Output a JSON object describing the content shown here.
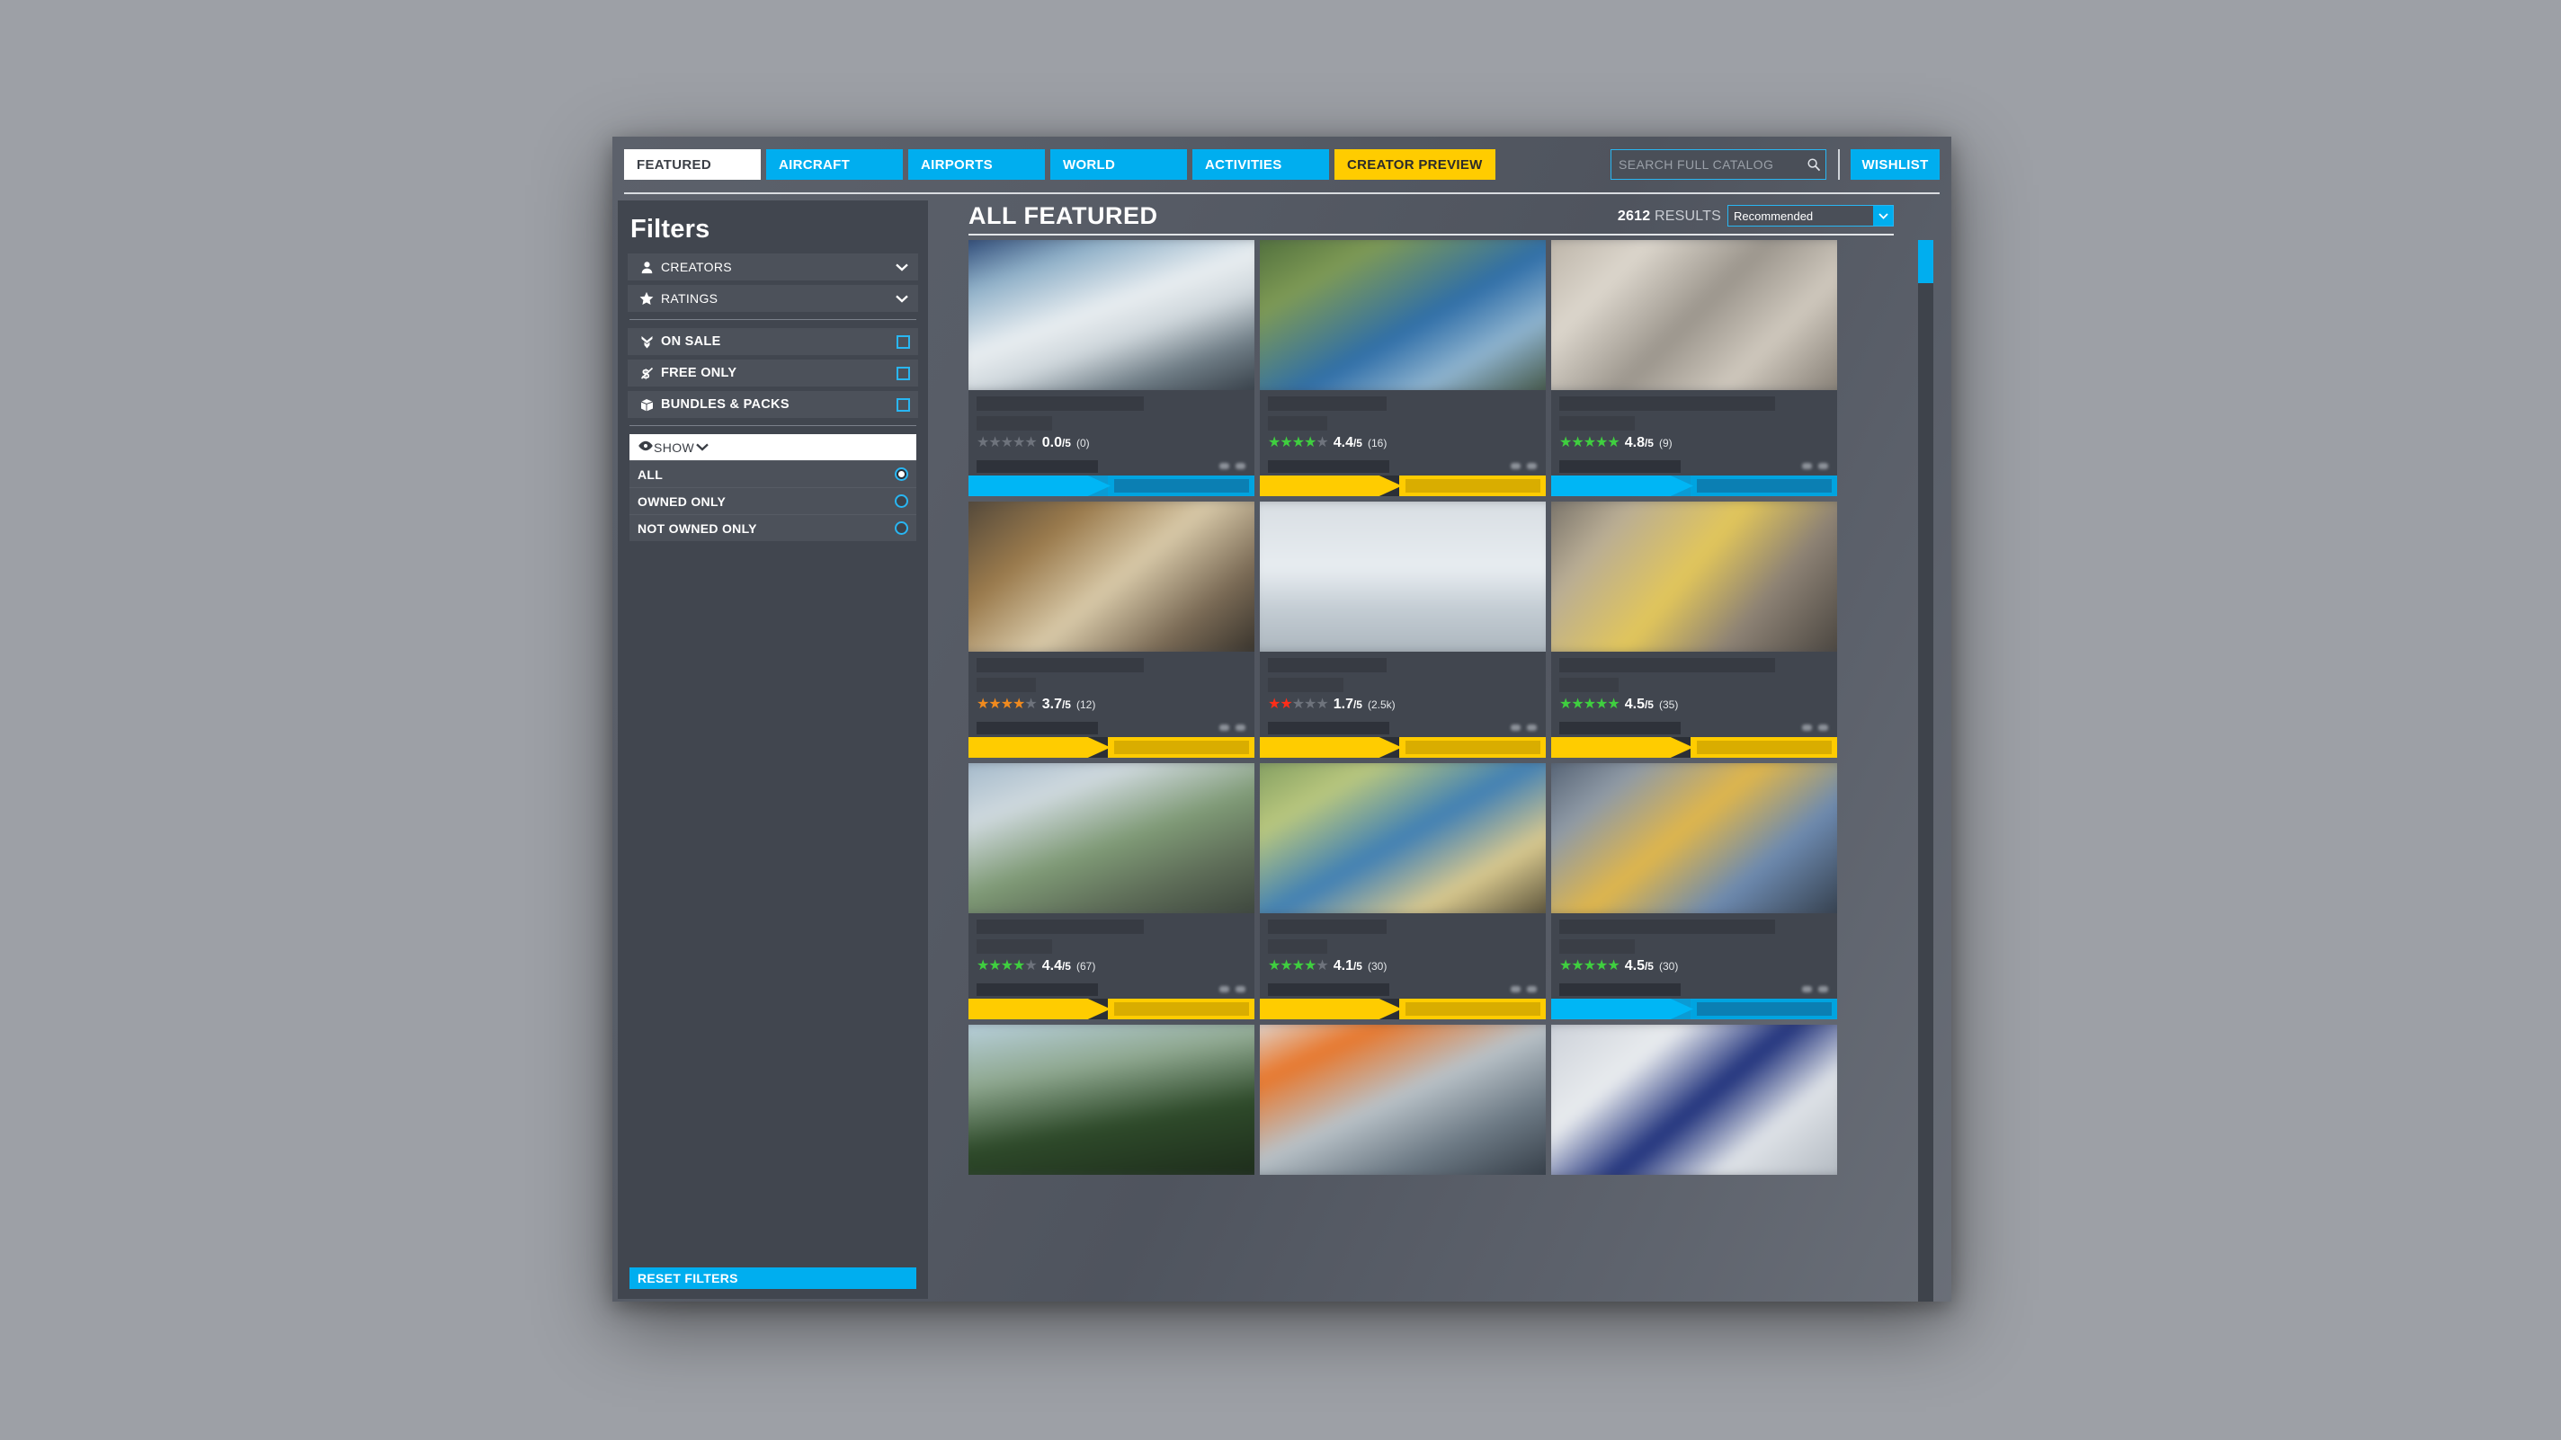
{
  "nav": {
    "tabs": [
      {
        "label": "FEATURED",
        "state": "active"
      },
      {
        "label": "AIRCRAFT",
        "state": "normal"
      },
      {
        "label": "AIRPORTS",
        "state": "normal"
      },
      {
        "label": "WORLD",
        "state": "normal"
      },
      {
        "label": "ACTIVITIES",
        "state": "normal"
      },
      {
        "label": "CREATOR PREVIEW",
        "state": "creator"
      }
    ],
    "search_placeholder": "SEARCH FULL CATALOG",
    "search_value": "",
    "wishlist_label": "WISHLIST"
  },
  "sidebar": {
    "title": "Filters",
    "collapsibles": [
      {
        "label": "CREATORS",
        "icon": "person-icon"
      },
      {
        "label": "RATINGS",
        "icon": "star-icon"
      }
    ],
    "checkboxes": [
      {
        "label": "ON SALE",
        "icon": "double-chevron-down-icon",
        "checked": false
      },
      {
        "label": "FREE ONLY",
        "icon": "dollar-slash-icon",
        "checked": false
      },
      {
        "label": "BUNDLES & PACKS",
        "icon": "box-icon",
        "checked": false
      }
    ],
    "show": {
      "label": "SHOW",
      "icon": "eye-icon",
      "expanded": true,
      "options": [
        {
          "label": "ALL",
          "selected": true
        },
        {
          "label": "OWNED ONLY",
          "selected": false
        },
        {
          "label": "NOT OWNED ONLY",
          "selected": false
        }
      ]
    },
    "reset_label": "RESET FILTERS"
  },
  "content": {
    "title": "ALL FEATURED",
    "results_count": "2612",
    "results_suffix": "RESULTS",
    "sort_value": "Recommended",
    "cards": [
      {
        "rating": "0.0",
        "scale": "/5",
        "count": "(0)",
        "stars_filled": 0,
        "star_color": "#6e737c",
        "bar": "blue",
        "img": "linear-gradient(160deg,#1f3a6b 0%,#8fb0c8 22%,#e9eef1 46%,#cfd7dc 60%,#6f7d86 78%,#2f3740 100%)"
      },
      {
        "rating": "4.4",
        "scale": "/5",
        "count": "(16)",
        "stars_filled": 4,
        "star_color": "#3fcf3f",
        "bar": "yellow",
        "img": "linear-gradient(150deg,#4b6a3a 0%,#7e9a55 25%,#2f6ea8 55%,#8fb4cf 75%,#3a4a35 100%)"
      },
      {
        "rating": "4.8",
        "scale": "/5",
        "count": "(9)",
        "stars_filled": 5,
        "star_color": "#3fcf3f",
        "bar": "blue",
        "img": "linear-gradient(135deg,#b8b0a4 0%,#dcd6cc 25%,#9b958c 50%,#cfc8bd 72%,#7d766d 100%)"
      },
      {
        "rating": "3.7",
        "scale": "/5",
        "count": "(12)",
        "stars_filled": 4,
        "star_color": "#f08a1e",
        "bar": "yellow",
        "img": "linear-gradient(140deg,#4a4238 0%,#9a7a4c 28%,#d8c9a8 52%,#7a6a55 76%,#2e2b26 100%)"
      },
      {
        "rating": "1.7",
        "scale": "/5",
        "count": "(2.5k)",
        "stars_filled": 2,
        "star_color": "#ff2d18",
        "bar": "yellow",
        "img": "linear-gradient(180deg,#d7dde2 0%,#e8edf1 45%,#c3ccd3 70%,#aab4bc 100%)"
      },
      {
        "rating": "4.5",
        "scale": "/5",
        "count": "(35)",
        "stars_filled": 5,
        "star_color": "#3fcf3f",
        "bar": "yellow",
        "img": "linear-gradient(130deg,#6f6a63 0%,#b9ad95 22%,#e2c65a 48%,#8d8275 70%,#433f3a 100%)"
      },
      {
        "rating": "4.4",
        "scale": "/5",
        "count": "(67)",
        "stars_filled": 4,
        "star_color": "#3fcf3f",
        "bar": "yellow",
        "img": "linear-gradient(160deg,#9fb6c9 0%,#cfd9de 26%,#7f9a76 52%,#5e6d58 74%,#39413a 100%)"
      },
      {
        "rating": "4.1",
        "scale": "/5",
        "count": "(30)",
        "stars_filled": 4,
        "star_color": "#3fcf3f",
        "bar": "yellow",
        "img": "linear-gradient(150deg,#7d9a5e 0%,#b9c77e 24%,#3f7fb5 50%,#d9c98e 74%,#4a4330 100%)"
      },
      {
        "rating": "4.5",
        "scale": "/5",
        "count": "(30)",
        "stars_filled": 5,
        "star_color": "#3fcf3f",
        "bar": "blue",
        "img": "linear-gradient(140deg,#4d5b6e 0%,#8f9aa6 22%,#e0b64a 46%,#6d8ab0 70%,#2f3843 100%)"
      },
      {
        "rating": "",
        "scale": "",
        "count": "",
        "stars_filled": 0,
        "star_color": "#6e737c",
        "bar": "none",
        "img": "linear-gradient(170deg,#bcd4e4 0%,#8fa890 32%,#2e4a2a 62%,#1c2a1a 100%)"
      },
      {
        "rating": "",
        "scale": "",
        "count": "",
        "stars_filled": 0,
        "star_color": "#6e737c",
        "bar": "none",
        "img": "linear-gradient(155deg,#dfe3e6 0%,#e8762a 22%,#b9c2c8 48%,#6d7a85 72%,#2f3741 100%)"
      },
      {
        "rating": "",
        "scale": "",
        "count": "",
        "stars_filled": 0,
        "star_color": "#6e737c",
        "bar": "none",
        "img": "linear-gradient(140deg,#c9ced6 0%,#e9ecef 30%,#1d2f7a 52%,#dfe3e8 72%,#aeb5bd 100%)"
      }
    ]
  },
  "colors": {
    "accent_blue": "#00aeef",
    "accent_yellow": "#ffcc00",
    "panel": "#41464f",
    "star_green": "#3fcf3f",
    "star_orange": "#f08a1e",
    "star_red": "#ff2d18",
    "star_empty": "#6e737c"
  }
}
